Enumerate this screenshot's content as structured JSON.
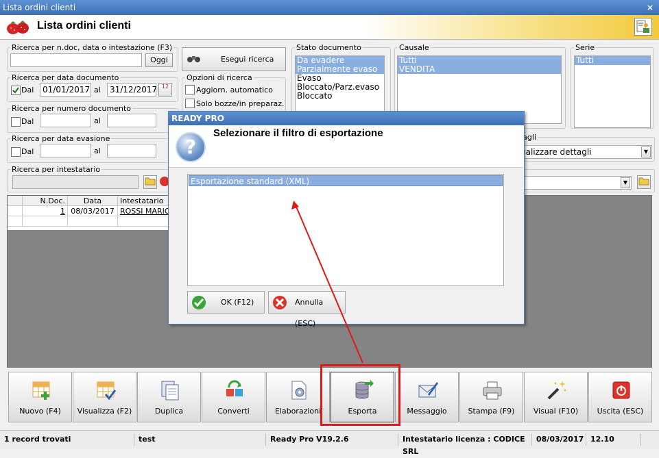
{
  "window": {
    "title": "Lista ordini clienti",
    "close_glyph": "×"
  },
  "header": {
    "title": "Lista ordini clienti"
  },
  "search_doc": {
    "legend": "Ricerca per n.doc, data o intestazione (F3)",
    "value": "",
    "button": "Oggi"
  },
  "search_btn": {
    "label": "Esegui ricerca"
  },
  "date_doc": {
    "legend": "Ricerca per data documento",
    "dal_label": "Dal",
    "checked": true,
    "from": "01/01/2017",
    "al_label": "al",
    "to": "31/12/2017"
  },
  "num_doc": {
    "legend": "Ricerca per numero documento",
    "dal_label": "Dal",
    "al_label": "al",
    "from": "",
    "to": ""
  },
  "date_evas": {
    "legend": "Ricerca per data evasione",
    "dal_label": "Dal",
    "al_label": "al",
    "from": "",
    "to": ""
  },
  "intest": {
    "legend": "Ricerca per intestatario",
    "value": ""
  },
  "options": {
    "legend": "Opzioni di ricerca",
    "auto": "Aggiorn. automatico",
    "drafts": "Solo bozze/in preparaz."
  },
  "stato": {
    "legend": "Stato documento",
    "items": [
      "Da evadere",
      "Parzialmente evaso",
      "Evaso",
      "Bloccato/Parz.evaso",
      "Bloccato"
    ],
    "selected": [
      0,
      1
    ]
  },
  "causale": {
    "legend": "Causale",
    "items": [
      "Tutti",
      "VENDITA"
    ],
    "selected": [
      0,
      1
    ]
  },
  "serie": {
    "legend": "Serie",
    "items": [
      "Tutti"
    ],
    "selected": [
      0
    ]
  },
  "dettagli": {
    "legend_partial": "zione dettagli",
    "value": "ualizzare dettagli"
  },
  "other": {
    "legend_partial": "zione"
  },
  "grid": {
    "headers": [
      "N.Doc.",
      "Data",
      "Intestatario"
    ],
    "rows": [
      [
        "1",
        "08/03/2017",
        "ROSSI MARIO"
      ]
    ]
  },
  "toolbar": [
    {
      "label": "Nuovo (F4)",
      "icon": "new-grid-icon"
    },
    {
      "label": "Visualizza (F2)",
      "icon": "view-grid-icon"
    },
    {
      "label": "Duplica",
      "icon": "duplicate-icon"
    },
    {
      "label": "Converti",
      "icon": "convert-icon"
    },
    {
      "label": "Elaborazioni",
      "icon": "processing-icon"
    },
    {
      "label": "Esporta",
      "icon": "export-database-icon"
    },
    {
      "label": "Messaggio",
      "icon": "message-icon"
    },
    {
      "label": "Stampa (F9)",
      "icon": "printer-icon"
    },
    {
      "label": "Visual (F10)",
      "icon": "magic-wand-icon"
    },
    {
      "label": "Uscita (ESC)",
      "icon": "exit-icon"
    }
  ],
  "status": {
    "records": "1 record trovati",
    "user": "test",
    "version": "Ready Pro V19.2.6",
    "license": "Intestatario licenza : CODICE SRL",
    "date": "08/03/2017",
    "time": "12.10"
  },
  "dialog": {
    "title": "READY PRO",
    "message": "Selezionare il filtro di esportazione",
    "options": [
      "Esportazione standard (XML)"
    ],
    "ok": "OK (F12)",
    "cancel": "Annulla (ESC)"
  },
  "colors": {
    "selection": "#8aaee0",
    "title_bar": "#4a7fc4",
    "highlight": "#e01818"
  }
}
